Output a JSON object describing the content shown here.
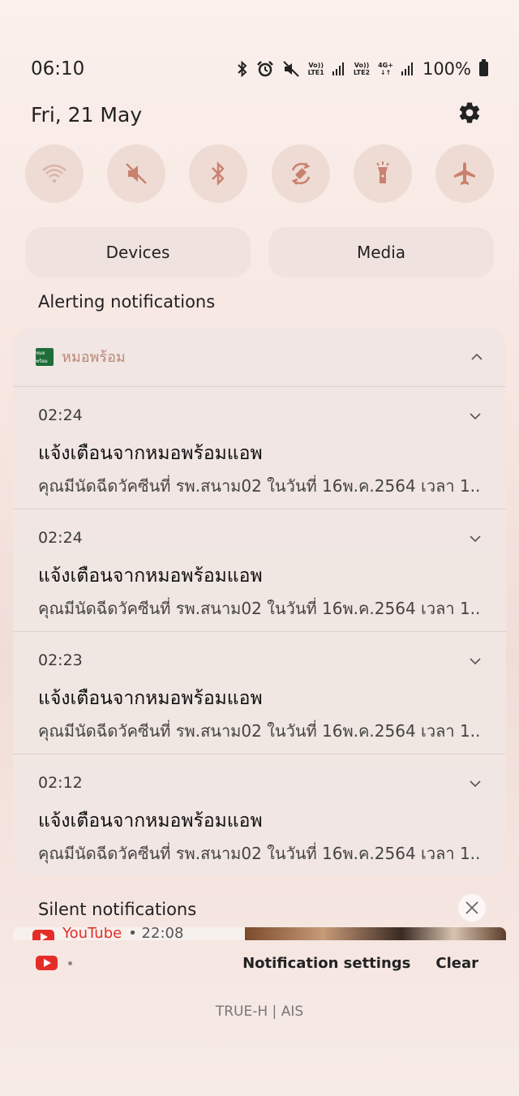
{
  "status_bar": {
    "time": "06:10",
    "icons": [
      "bluetooth-icon",
      "alarm-icon",
      "mute-icon",
      "volte-lte1-icon",
      "signal-icon",
      "volte-lte2-icon",
      "4g-plus-icon",
      "signal-icon"
    ],
    "lte1_top": "Vo))",
    "lte1_bottom": "LTE1",
    "lte2_top": "Vo))",
    "lte2_bottom": "LTE2",
    "net_top": "4G+",
    "net_bottom": "↓↑",
    "battery": "100%"
  },
  "header": {
    "date": "Fri, 21 May"
  },
  "quick_settings": [
    {
      "name": "wifi",
      "icon": "wifi-icon"
    },
    {
      "name": "sound",
      "icon": "mute-icon"
    },
    {
      "name": "bluetooth",
      "icon": "bluetooth-icon"
    },
    {
      "name": "auto-rotate",
      "icon": "rotate-icon"
    },
    {
      "name": "flashlight",
      "icon": "flashlight-icon"
    },
    {
      "name": "airplane",
      "icon": "airplane-icon"
    }
  ],
  "pills": {
    "devices": "Devices",
    "media": "Media"
  },
  "alerting": {
    "label": "Alerting notifications",
    "app_name": "หมอพร้อม",
    "app_icon_text": "หมอพร้อม",
    "notifications": [
      {
        "time": "02:24",
        "title": "แจ้งเตือนจากหมอพร้อมแอพ",
        "body": "คุณมีนัดฉีดวัคซีนที่ รพ.สนาม02 ในวันที่ 16พ.ค.2564 เวลา 1.."
      },
      {
        "time": "02:24",
        "title": "แจ้งเตือนจากหมอพร้อมแอพ",
        "body": "คุณมีนัดฉีดวัคซีนที่ รพ.สนาม02 ในวันที่ 16พ.ค.2564 เวลา 1.."
      },
      {
        "time": "02:23",
        "title": "แจ้งเตือนจากหมอพร้อมแอพ",
        "body": "คุณมีนัดฉีดวัคซีนที่ รพ.สนาม02 ในวันที่ 16พ.ค.2564 เวลา 1.."
      },
      {
        "time": "02:12",
        "title": "แจ้งเตือนจากหมอพร้อมแอพ",
        "body": "คุณมีนัดฉีดวัคซีนที่ รพ.สนาม02 ในวันที่ 16พ.ค.2564 เวลา 1.."
      }
    ]
  },
  "silent": {
    "label": "Silent notifications",
    "youtube_label": "YouTube",
    "youtube_time": "• 22:08"
  },
  "footer": {
    "notification_settings": "Notification settings",
    "clear": "Clear",
    "carrier": "TRUE-H | AIS"
  },
  "colors": {
    "accent_app": "#b98778",
    "youtube_red": "#e52d27",
    "quick_icon": "#c9826e"
  }
}
